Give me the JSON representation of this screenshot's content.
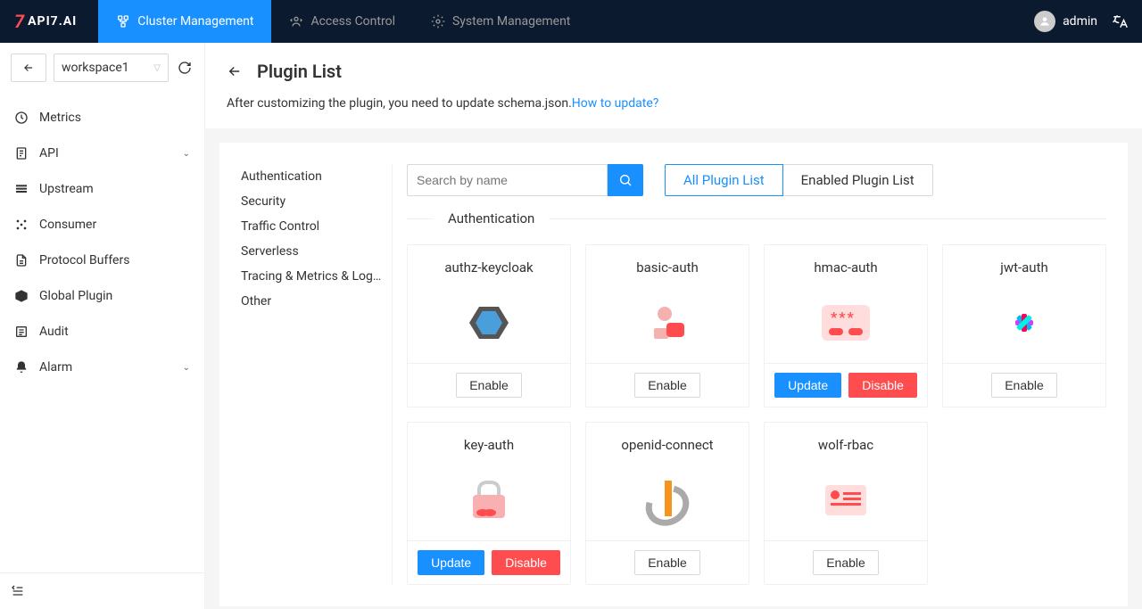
{
  "header": {
    "logo_text": "API7.AI",
    "nav": [
      {
        "label": "Cluster Management",
        "active": true
      },
      {
        "label": "Access Control",
        "active": false
      },
      {
        "label": "System Management",
        "active": false
      }
    ],
    "user": "admin"
  },
  "sidebar": {
    "workspace": "workspace1",
    "items": [
      {
        "label": "Metrics",
        "expandable": false
      },
      {
        "label": "API",
        "expandable": true
      },
      {
        "label": "Upstream",
        "expandable": false
      },
      {
        "label": "Consumer",
        "expandable": false
      },
      {
        "label": "Protocol Buffers",
        "expandable": false
      },
      {
        "label": "Global Plugin",
        "expandable": false
      },
      {
        "label": "Audit",
        "expandable": false
      },
      {
        "label": "Alarm",
        "expandable": true
      }
    ]
  },
  "page": {
    "title": "Plugin List",
    "desc": "After customizing the plugin, you need to update schema.json.",
    "desc_link": "How to update?"
  },
  "categories": [
    "Authentication",
    "Security",
    "Traffic Control",
    "Serverless",
    "Tracing & Metrics & Loggi...",
    "Other"
  ],
  "toolbar": {
    "search_placeholder": "Search by name",
    "tab_all": "All Plugin List",
    "tab_enabled": "Enabled Plugin List"
  },
  "section_title": "Authentication",
  "buttons": {
    "enable": "Enable",
    "update": "Update",
    "disable": "Disable"
  },
  "plugins": [
    {
      "name": "authz-keycloak",
      "icon": "keycloak",
      "enabled": false
    },
    {
      "name": "basic-auth",
      "icon": "basic",
      "enabled": false
    },
    {
      "name": "hmac-auth",
      "icon": "hmac",
      "enabled": true
    },
    {
      "name": "jwt-auth",
      "icon": "jwt",
      "enabled": false
    },
    {
      "name": "key-auth",
      "icon": "key",
      "enabled": true
    },
    {
      "name": "openid-connect",
      "icon": "openid",
      "enabled": false
    },
    {
      "name": "wolf-rbac",
      "icon": "wolf",
      "enabled": false
    }
  ]
}
